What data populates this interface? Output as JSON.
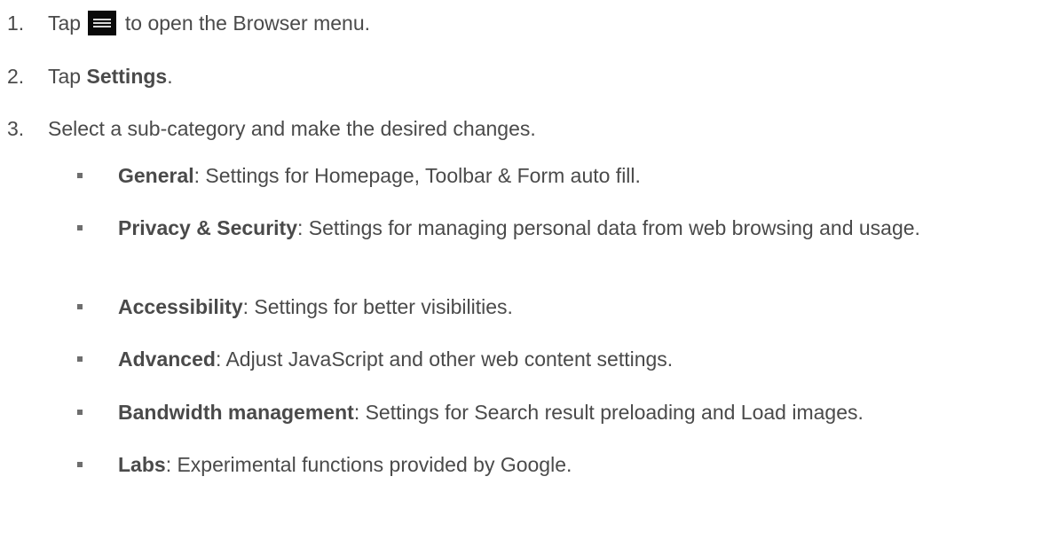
{
  "steps": [
    {
      "number": "1.",
      "before_icon": "Tap",
      "icon": "menu-icon",
      "after_icon": "to open the Browser menu."
    },
    {
      "number": "2.",
      "prefix": "Tap",
      "bold": "Settings",
      "suffix": "."
    },
    {
      "number": "3.",
      "text": "Select a sub-category and make the desired changes."
    }
  ],
  "subcategories": [
    {
      "name": "General",
      "description": ": Settings for Homepage, Toolbar & Form auto fill."
    },
    {
      "name": "Privacy & Security",
      "description": ": Settings for managing personal data from web browsing and usage."
    },
    {
      "name": "Accessibility",
      "description": ": Settings for better visibilities."
    },
    {
      "name": "Advanced",
      "description": ": Adjust JavaScript and other web content settings."
    },
    {
      "name": "Bandwidth management",
      "description": ": Settings for Search result preloading and Load images."
    },
    {
      "name": "Labs",
      "description": ": Experimental functions provided by Google."
    }
  ]
}
